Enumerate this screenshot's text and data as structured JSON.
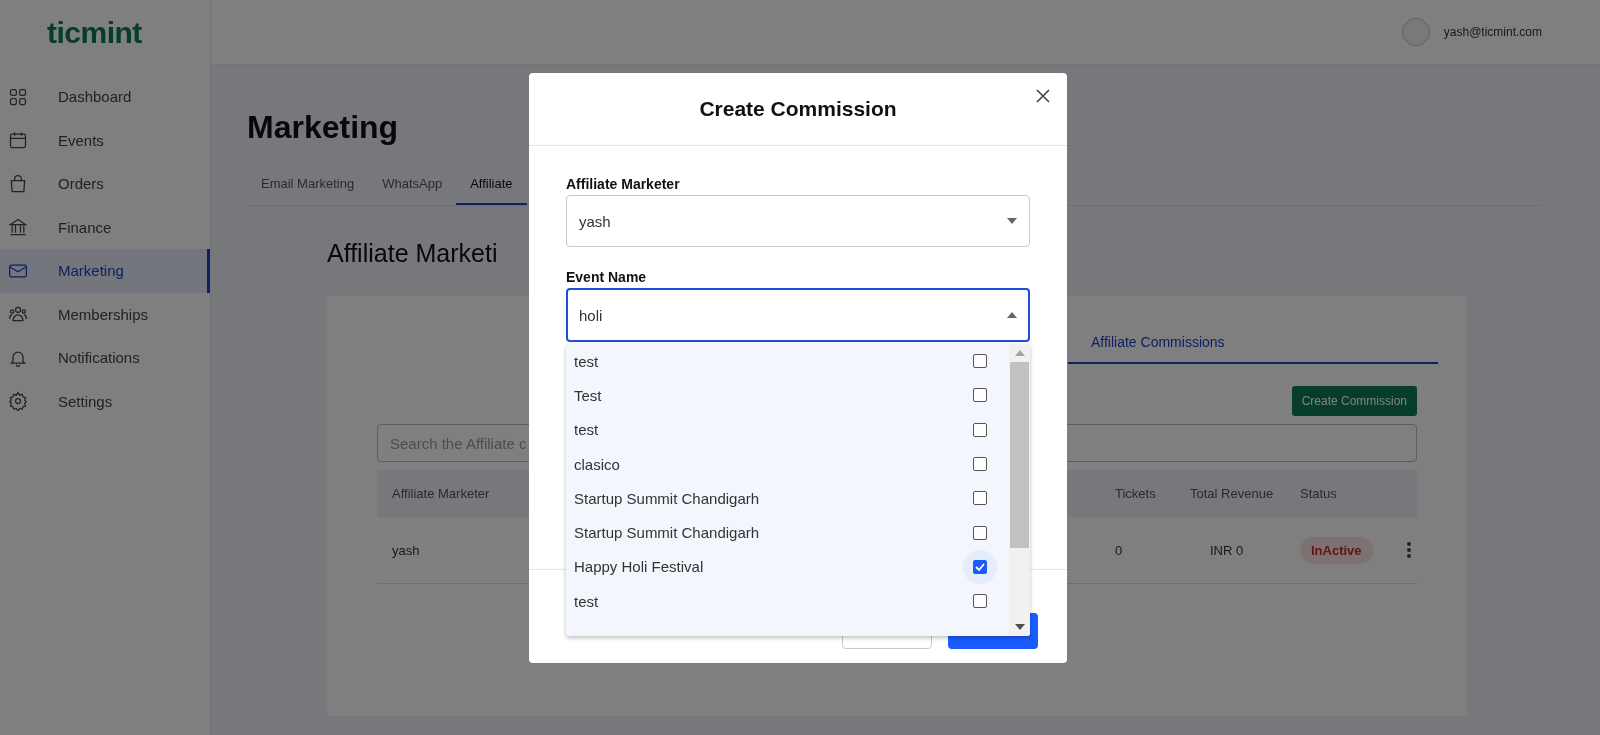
{
  "brand": {
    "logo": "ticmint"
  },
  "user": {
    "email": "yash@ticmint.com"
  },
  "sidebar": {
    "items": [
      {
        "label": "Dashboard",
        "selected": false
      },
      {
        "label": "Events",
        "selected": false
      },
      {
        "label": "Orders",
        "selected": false
      },
      {
        "label": "Finance",
        "selected": false
      },
      {
        "label": "Marketing",
        "selected": true
      },
      {
        "label": "Memberships",
        "selected": false
      },
      {
        "label": "Notifications",
        "selected": false
      },
      {
        "label": "Settings",
        "selected": false
      }
    ]
  },
  "page": {
    "title": "Marketing",
    "tabs": [
      {
        "label": "Email Marketing",
        "selected": false
      },
      {
        "label": "WhatsApp",
        "selected": false
      },
      {
        "label": "Affiliate",
        "selected": true
      }
    ],
    "section_title": "Affiliate Marketi",
    "card": {
      "tabs": [
        {
          "label": "Affiliate Commissions",
          "selected": true
        }
      ],
      "create_button": "Create Commission",
      "search": {
        "placeholder": "Search the Affiliate c"
      },
      "table": {
        "columns": [
          "Affiliate Marketer",
          "Tickets",
          "Total Revenue",
          "Status"
        ],
        "rows": [
          {
            "affiliate_marketer": "yash",
            "tickets": "0",
            "total_revenue": "INR 0",
            "status": "InActive",
            "status_active": false
          }
        ]
      }
    }
  },
  "modal": {
    "title": "Create Commission",
    "fields": [
      {
        "label": "Affiliate Marketer",
        "value": "yash",
        "expanded": false
      },
      {
        "label": "Event Name",
        "value": "holi",
        "expanded": true
      }
    ],
    "options": [
      {
        "label": "test",
        "checked": false
      },
      {
        "label": "Test",
        "checked": false
      },
      {
        "label": "test",
        "checked": false
      },
      {
        "label": "clasico",
        "checked": false
      },
      {
        "label": "Startup Summit Chandigarh",
        "checked": false
      },
      {
        "label": "Startup Summit Chandigarh",
        "checked": false
      },
      {
        "label": "Happy Holi Festival",
        "checked": true
      },
      {
        "label": "test",
        "checked": false
      }
    ]
  }
}
